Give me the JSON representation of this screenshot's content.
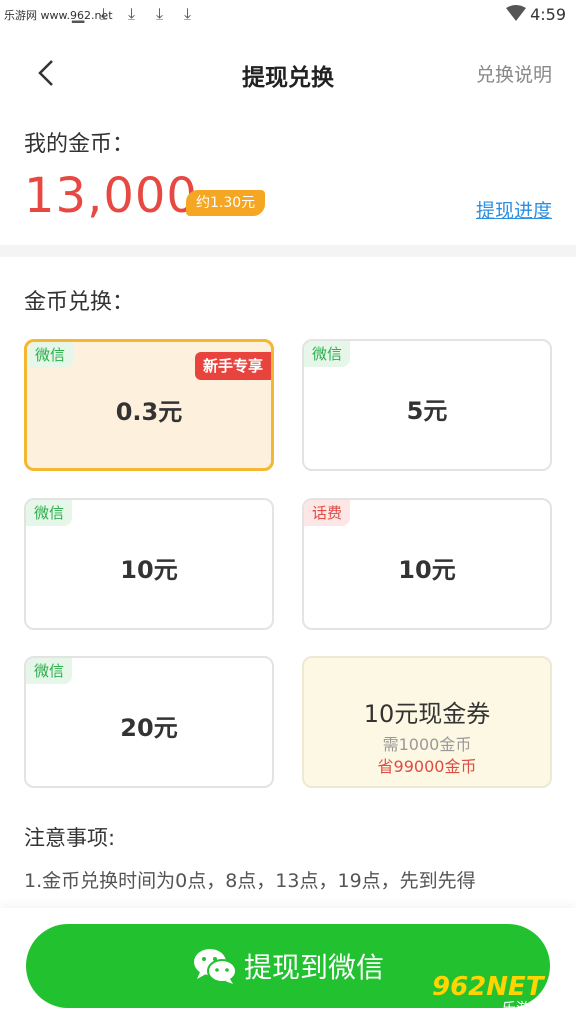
{
  "status_bar": {
    "watermark": "乐游网 www.962.net",
    "time": "4:59"
  },
  "header": {
    "title": "提现兑换",
    "right_link": "兑换说明",
    "back_icon": "chevron-left-icon"
  },
  "coins": {
    "label": "我的金币：",
    "value": "13,000",
    "approx": "约1.30元",
    "progress_link": "提现进度"
  },
  "exchange": {
    "label": "金币兑换：",
    "cards": [
      {
        "tag": "微信",
        "tag_type": "wechat",
        "amount": "0.3元",
        "badge": "新手专享",
        "selected": true
      },
      {
        "tag": "微信",
        "tag_type": "wechat",
        "amount": "5元"
      },
      {
        "tag": "微信",
        "tag_type": "wechat",
        "amount": "10元"
      },
      {
        "tag": "话费",
        "tag_type": "phone",
        "amount": "10元"
      },
      {
        "tag": "微信",
        "tag_type": "wechat",
        "amount": "20元"
      }
    ],
    "voucher": {
      "title": "10元现金券",
      "need": "需1000金币",
      "save": "省99000金币"
    }
  },
  "notes": {
    "title": "注意事项:",
    "line1": "1.金币兑换时间为0点，8点，13点，19点，先到先得"
  },
  "withdraw_button": {
    "label": "提现到微信",
    "icon": "wechat-icon"
  },
  "watermark_logo": {
    "text": "962NET",
    "sub": "乐游网"
  },
  "colors": {
    "accent_red": "#e84842",
    "green": "#21c12f",
    "orange": "#f5a623",
    "link_blue": "#2d8fe0"
  }
}
